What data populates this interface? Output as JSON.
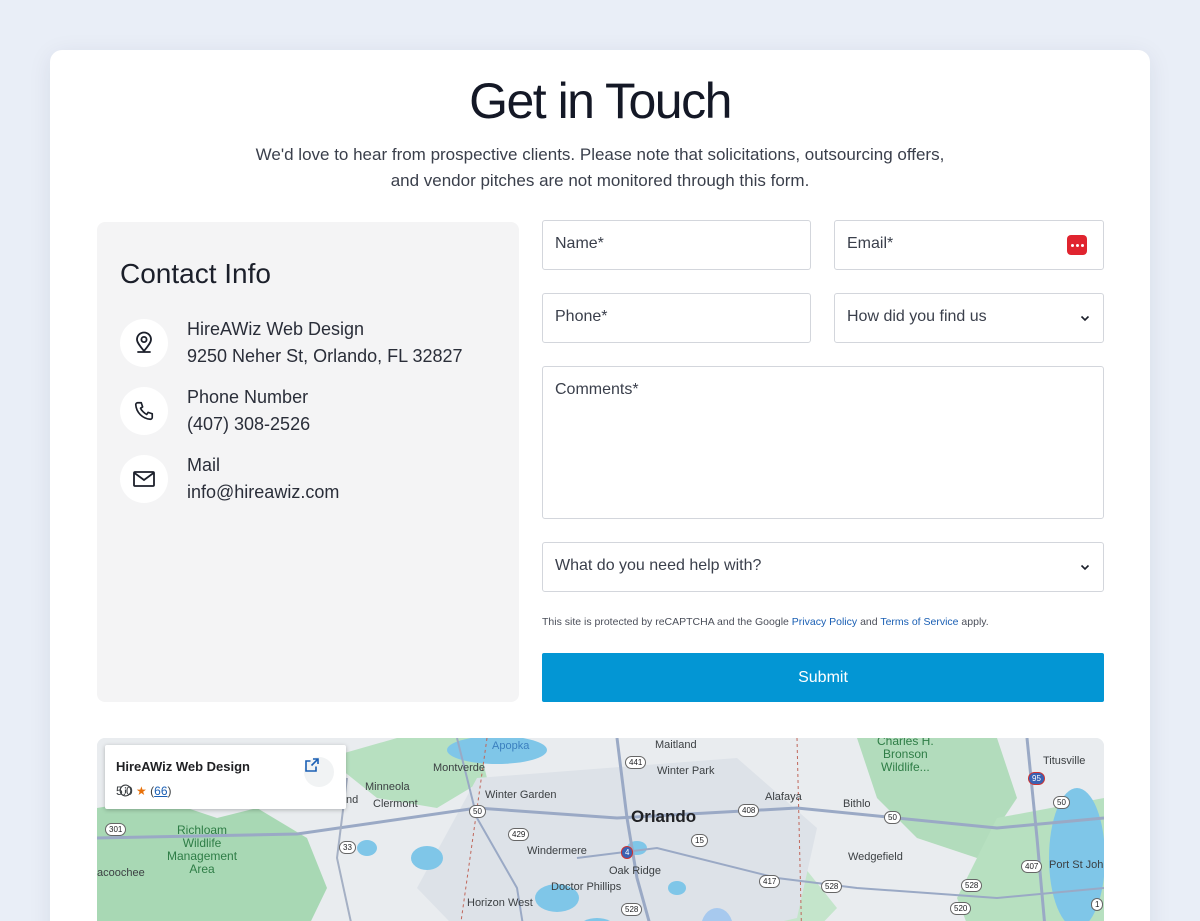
{
  "header": {
    "title": "Get in Touch",
    "subtitle_line1": "We'd love to hear from prospective clients. Please note that solicitations, outsourcing offers,",
    "subtitle_line2": "and vendor pitches are not monitored through this form."
  },
  "contact_info": {
    "heading": "Contact Info",
    "address": {
      "label": "HireAWiz Web Design",
      "value": "9250 Neher St, Orlando, FL 32827",
      "icon": "location-pin-icon"
    },
    "phone": {
      "label": "Phone Number",
      "value": "(407) 308-2526",
      "icon": "phone-icon"
    },
    "mail": {
      "label": "Mail",
      "value": "info@hireawiz.com",
      "icon": "mail-icon"
    }
  },
  "form": {
    "name_placeholder": "Name*",
    "email_placeholder": "Email*",
    "phone_placeholder": "Phone*",
    "find_us_selected": "How did you find us",
    "comments_placeholder": "Comments*",
    "help_selected": "What do you need help with?",
    "recaptcha_prefix": "This site is protected by reCAPTCHA and the Google ",
    "privacy_link": "Privacy Policy",
    "recaptcha_and": " and ",
    "terms_link": "Terms of Service",
    "recaptcha_suffix": " apply.",
    "submit_label": "Submit",
    "accent_color": "#0396d4"
  },
  "map": {
    "card_title": "HireAWiz Web Design",
    "rating": "5.0",
    "reviews": "66",
    "places": {
      "apopka": "Apopka",
      "maitland": "Maitland",
      "montverde": "Montverde",
      "winter_park": "Winter Park",
      "minneola": "Minneola",
      "winter_garden": "Winter Garden",
      "alafaya": "Alafaya",
      "clermont": "Clermont",
      "nd": "nd",
      "orlando": "Orlando",
      "bithlo": "Bithlo",
      "richloam": "Richloam",
      "wildlife": "Wildlife",
      "management": "Management",
      "area": "Area",
      "windermere": "Windermere",
      "wedgefield": "Wedgefield",
      "oak_ridge": "Oak Ridge",
      "doctor_phillips": "Doctor Phillips",
      "coochee": "acoochee",
      "horizon_west": "Horizon West",
      "titusville": "Titusville",
      "port_st_john": "Port St Joh",
      "charles_h": "Charles H.",
      "bronson": "Bronson",
      "wildlife2": "Wildlife..."
    },
    "shields": [
      "441",
      "50",
      "429",
      "408",
      "301",
      "33",
      "15",
      "417",
      "528",
      "528",
      "50",
      "50",
      "407",
      "520",
      "528",
      "4",
      "95",
      "1"
    ]
  }
}
